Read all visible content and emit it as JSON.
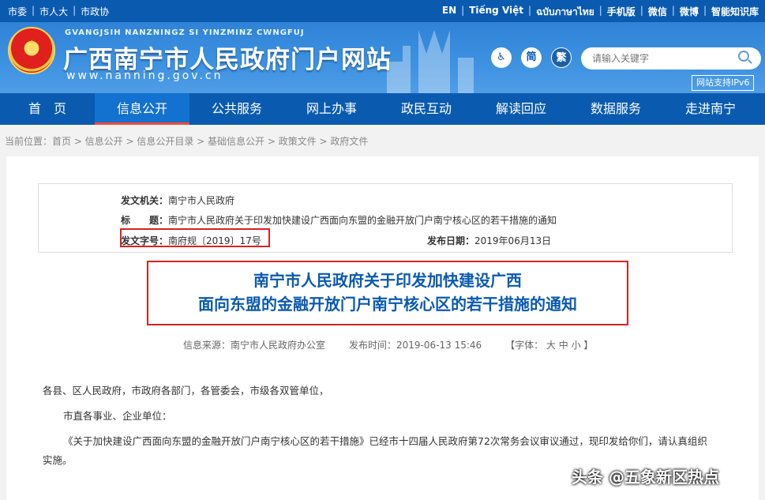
{
  "topbar": {
    "left": [
      "市委",
      "市人大",
      "市政协"
    ],
    "right": [
      "EN",
      "Tiếng Việt",
      "ฉบับภาษาไทย",
      "手机版",
      "微信",
      "微博",
      "智能知识库"
    ]
  },
  "header": {
    "pinyin": "GVANGJSIH NANZNINGZ SI YINZMINZ CWNGFUJ",
    "title": "广西南宁市人民政府门户网站",
    "url": "www.nanning.gov.cn",
    "btn_simplified": "简",
    "btn_traditional": "繁",
    "search_placeholder": "请输入关键字",
    "ipv6": "网站支持IPv6"
  },
  "nav": [
    "首　页",
    "信息公开",
    "公共服务",
    "网上办事",
    "政民互动",
    "解读回应",
    "数据服务",
    "走进南宁"
  ],
  "breadcrumb": "当前位置：首页 > 信息公开 > 信息公开目录 > 基础信息公开 > 政策文件 > 政府文件",
  "meta": {
    "issuer_label": "发文机关：",
    "issuer": "南宁市人民政府",
    "title_label": "标　　题：",
    "title": "南宁市人民政府关于印发加快建设广西面向东盟的金融开放门户南宁核心区的若干措施的通知",
    "docno_label": "发文字号：",
    "docno": "南府规〔2019〕17号",
    "date_label": "发布日期：",
    "date": "2019年06月13日"
  },
  "doc": {
    "title_line1": "南宁市人民政府关于印发加快建设广西",
    "title_line2": "面向东盟的金融开放门户南宁核心区的若干措施的通知",
    "source": "信息来源：南宁市人民政府办公室",
    "time": "发布时间：2019-06-13 15:46",
    "font": "【字体： 大  中  小 】",
    "p1": "各县、区人民政府，市政府各部门，各管委会，市级各双管单位，",
    "p2": "市直各事业、企业单位：",
    "p3a": "《关于加快建设广西面向东盟的金融开放门户南宁核心区的若干措施》已经市十四届人民政府第72次常务会议审议通过，现印发给你们，请认真组织",
    "p3b": "实施。"
  },
  "watermark": "头条 @五象新区热点",
  "colors": {
    "primary": "#0a5ab0",
    "red": "#d8231f"
  }
}
